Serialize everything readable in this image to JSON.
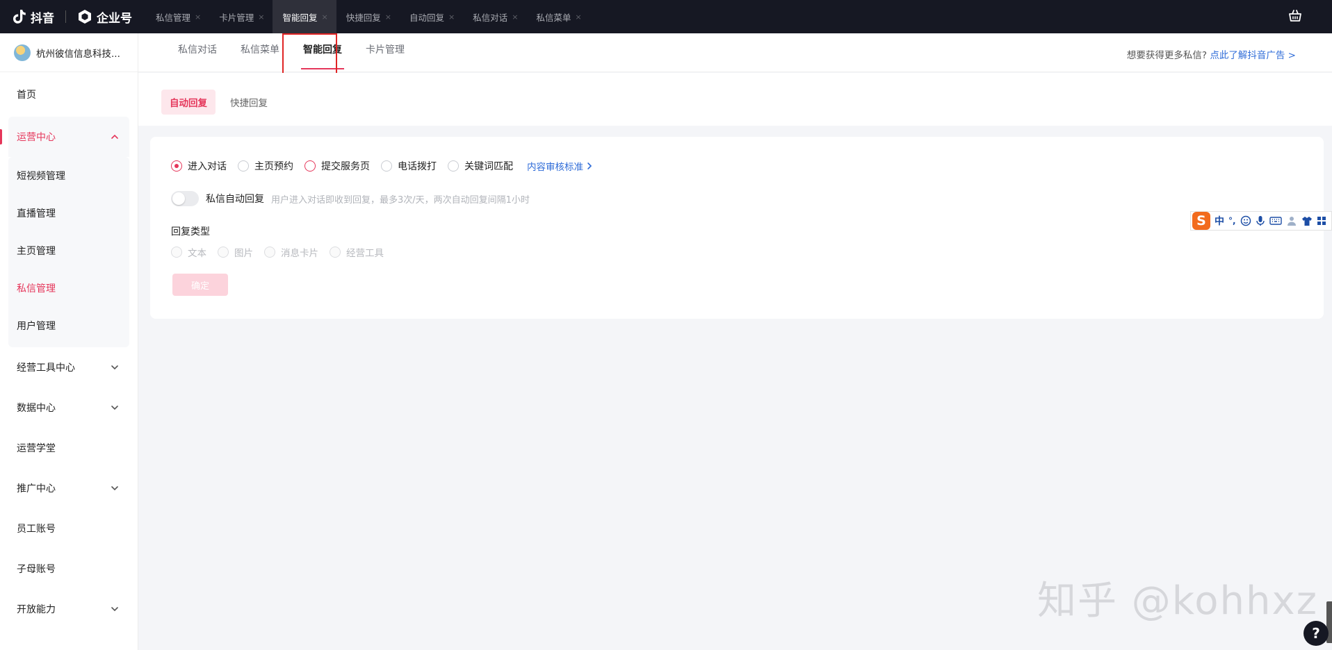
{
  "brand": {
    "douyin": "抖音",
    "enterprise": "企业号"
  },
  "top_tabs": [
    {
      "label": "私信管理",
      "active": false
    },
    {
      "label": "卡片管理",
      "active": false
    },
    {
      "label": "智能回复",
      "active": true
    },
    {
      "label": "快捷回复",
      "active": false
    },
    {
      "label": "自动回复",
      "active": false
    },
    {
      "label": "私信对话",
      "active": false
    },
    {
      "label": "私信菜单",
      "active": false
    }
  ],
  "top_tab_close": "×",
  "sidebar": {
    "company": "杭州彼信信息科技...",
    "home": "首页",
    "ops_center": "运营中心",
    "ops_children": [
      "短视频管理",
      "直播管理",
      "主页管理",
      "私信管理",
      "用户管理"
    ],
    "business_tools": "经营工具中心",
    "data_center": "数据中心",
    "ops_school": "运营学堂",
    "promo_center": "推广中心",
    "staff_account": "员工账号",
    "sub_account": "子母账号",
    "open_capability": "开放能力"
  },
  "section_tabs": [
    "私信对话",
    "私信菜单",
    "智能回复",
    "卡片管理"
  ],
  "promo": {
    "text": "想要获得更多私信?",
    "link": "点此了解抖音广告 >"
  },
  "sub_tabs": {
    "active": "自动回复",
    "other": "快捷回复"
  },
  "scene_options": [
    "进入对话",
    "主页预约",
    "提交服务页",
    "电话拨打",
    "关键词匹配"
  ],
  "content_standard_link": "内容审核标准",
  "auto_reply": {
    "label": "私信自动回复",
    "hint": "用户进入对话即收到回复，最多3次/天，两次自动回复间隔1小时",
    "enabled": false
  },
  "reply_type": {
    "label": "回复类型",
    "options": [
      "文本",
      "图片",
      "消息卡片",
      "经营工具"
    ]
  },
  "confirm_label": "确定",
  "ime": {
    "lang": "中",
    "punct": "°,"
  },
  "watermark": "知乎 @kohhxz",
  "help": "?",
  "colors": {
    "accent": "#e5365a",
    "topbar": "#161823",
    "link": "#2f6cd8"
  }
}
